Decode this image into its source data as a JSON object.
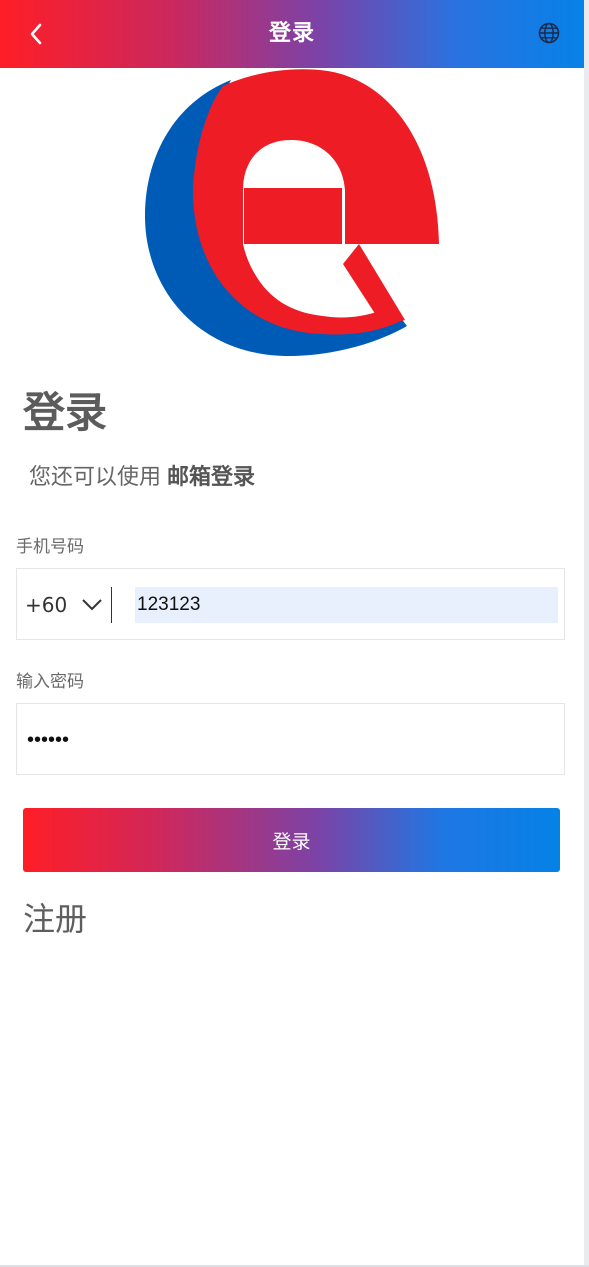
{
  "header": {
    "title": "登录",
    "back_icon": "chevron-left-icon",
    "language_icon": "globe-icon"
  },
  "logo": {
    "letter": "e",
    "colors": {
      "red": "#ee1c25",
      "blue": "#005bb7"
    }
  },
  "page": {
    "title": "登录",
    "alt_prefix": "您还可以使用",
    "alt_link": "邮箱登录"
  },
  "phone": {
    "label": "手机号码",
    "country_code": "+60",
    "value": "123123"
  },
  "password": {
    "label": "输入密码",
    "value": "123123"
  },
  "buttons": {
    "login": "登录",
    "register": "注册"
  },
  "colors": {
    "gradient_start": "#ff1e26",
    "gradient_end": "#0682e8"
  }
}
